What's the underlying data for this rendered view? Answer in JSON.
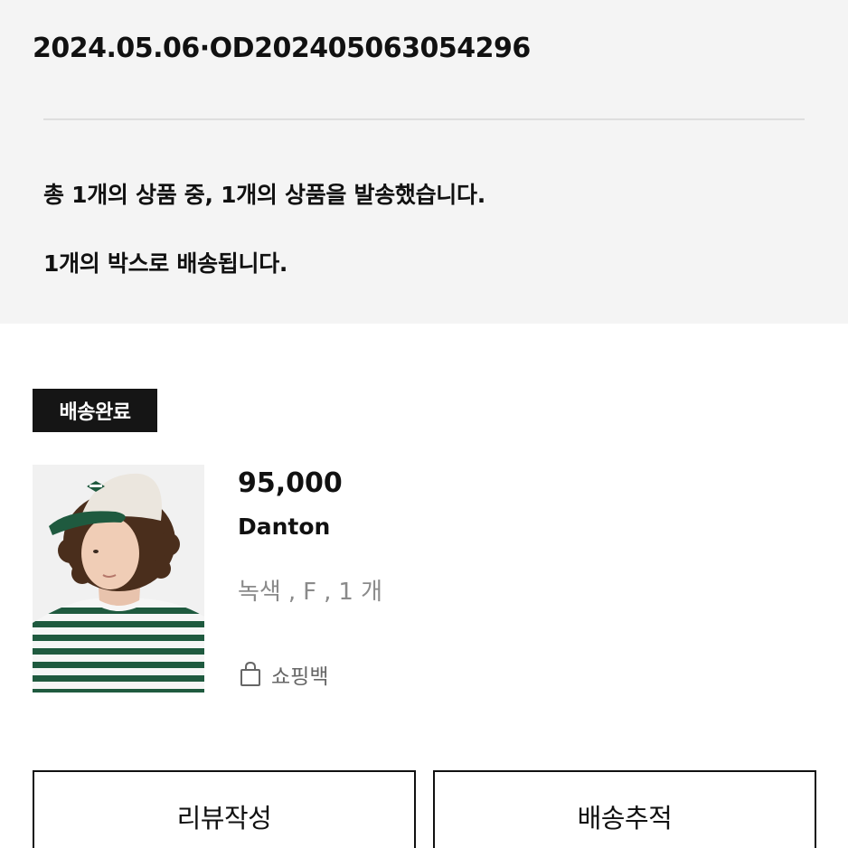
{
  "order": {
    "date_id": "2024.05.06·OD202405063054296"
  },
  "summary": {
    "shipped_text": "총 1개의 상품 중, 1개의 상품을 발송했습니다.",
    "box_text": "1개의 박스로 배송됩니다."
  },
  "shipment": {
    "status": "배송완료"
  },
  "product": {
    "price": "95,000",
    "brand": "Danton",
    "options": [
      "녹색",
      "F",
      "1 개"
    ],
    "option_separator": ",",
    "packaging_label": "쇼핑백",
    "packaging_icon": "shopping-bag-icon",
    "image_description_icon": "product-photo"
  },
  "actions": {
    "review_label": "리뷰작성",
    "tracking_label": "배송추적"
  },
  "colors": {
    "badge_bg": "#151515",
    "header_bg": "#f4f4f4",
    "option_text": "#8a8a8a"
  }
}
